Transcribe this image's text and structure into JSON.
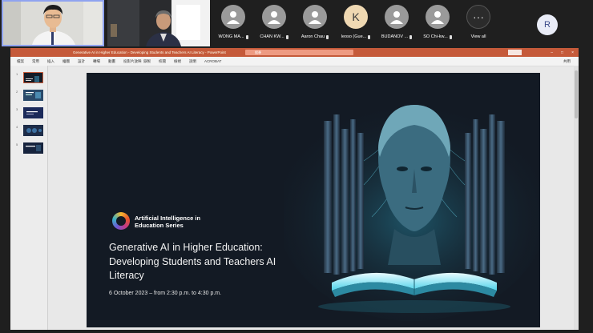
{
  "participants": [
    {
      "name": "WONG MA..."
    },
    {
      "name": "CHAN KW..."
    },
    {
      "name": "Aaron Chau"
    },
    {
      "name": "leoso (Gue...",
      "initial": "K"
    },
    {
      "name": "BUDANOV ..."
    },
    {
      "name": "SO Chi-kw..."
    }
  ],
  "view_all": {
    "glyph": "···",
    "label": "View all"
  },
  "self_avatar": "R",
  "powerpoint": {
    "doc_title": "Generative AI in Higher Education - Developing Students and Teachers AI Literacy  -  PowerPoint",
    "search_placeholder": "搜尋",
    "ribbon": [
      "檔案",
      "常用",
      "插入",
      "繪圖",
      "設計",
      "轉場",
      "動畫",
      "投影片放映",
      "錄製",
      "校閱",
      "檢視",
      "說明",
      "ACROBAT"
    ],
    "share_label": "共用",
    "slide_numbers": [
      "1",
      "2",
      "3",
      "4",
      "5"
    ],
    "slide": {
      "series_title": "Artificial Intelligence in Education Series",
      "headline": "Generative AI in Higher Education: Developing Students and Teachers AI Literacy",
      "date_line": "6 October 2023 – from 2:30 p.m. to 4:30 p.m."
    }
  },
  "colors": {
    "powerpoint_accent": "#c55a3a",
    "slide_background": "#131a24",
    "tile_highlight": "#8fa3f0"
  }
}
